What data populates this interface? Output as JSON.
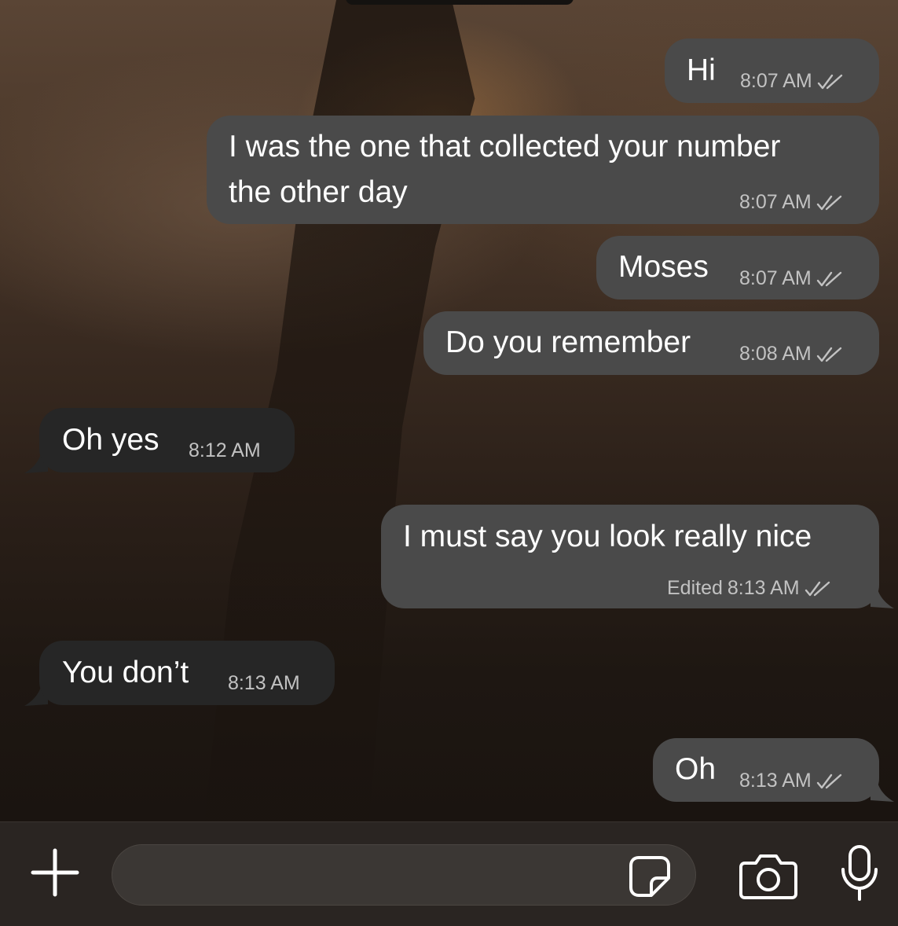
{
  "conversation": {
    "messages": [
      {
        "direction": "outgoing",
        "text": "Hi",
        "time": "8:07 AM",
        "status": "read"
      },
      {
        "direction": "outgoing",
        "line1": "I was the one that collected your number",
        "line2": "the other day",
        "time": "8:07 AM",
        "status": "read"
      },
      {
        "direction": "outgoing",
        "text": "Moses",
        "time": "8:07 AM",
        "status": "read"
      },
      {
        "direction": "outgoing",
        "text": "Do you remember",
        "time": "8:08 AM",
        "status": "read"
      },
      {
        "direction": "incoming",
        "text": "Oh yes",
        "time": "8:12 AM"
      },
      {
        "direction": "outgoing",
        "text": "I must say you look really nice",
        "edited_label": "Edited",
        "time": "8:13 AM",
        "status": "read"
      },
      {
        "direction": "incoming",
        "text": "You don’t",
        "time": "8:13 AM"
      },
      {
        "direction": "outgoing",
        "text": "Oh",
        "time": "8:13 AM",
        "status": "read"
      }
    ]
  },
  "composer": {
    "input_value": "",
    "icons": [
      "plus-icon",
      "sticker-icon",
      "camera-icon",
      "microphone-icon"
    ]
  },
  "colors": {
    "outgoing_bubble": "#4a4a4a",
    "incoming_bubble": "#262626",
    "meta_text": "#c2c2c2",
    "input_bar": "#2a2522"
  }
}
